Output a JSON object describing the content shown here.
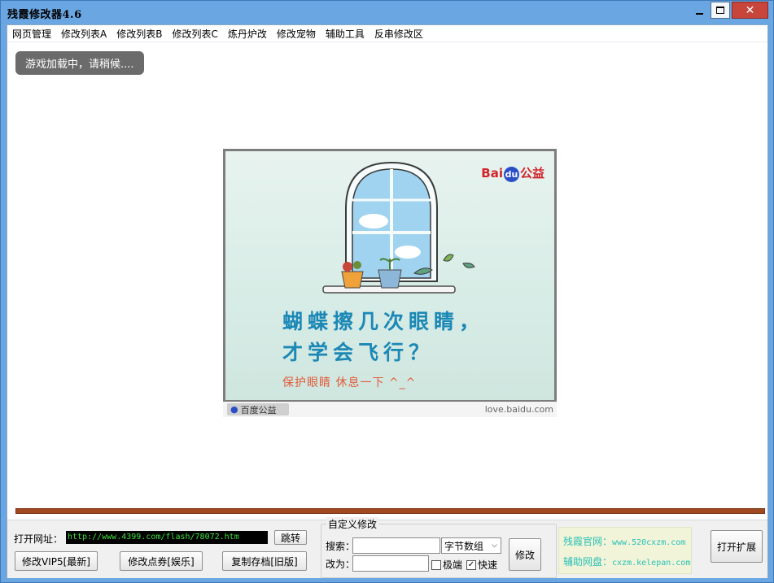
{
  "window": {
    "title": "残霞修改器4.6",
    "close_glyph": "✕"
  },
  "menu": [
    "网页管理",
    "修改列表A",
    "修改列表B",
    "修改列表C",
    "炼丹炉改",
    "修改宠物",
    "辅助工具",
    "反串修改区"
  ],
  "content": {
    "loading_text": "游戏加载中，请稍候....",
    "ad": {
      "logo_left": "Bai",
      "logo_du": "du",
      "logo_right": "公益",
      "line1": "蝴蝶擦几次眼睛，",
      "line2": "才学会飞行？",
      "subline": "保护眼睛 休息一下 ^_^",
      "footer_badge": "百度公益",
      "footer_url": "love.baidu.com"
    }
  },
  "progress": {
    "value": 100,
    "color": "#a14a22"
  },
  "bottom": {
    "open_url_label": "打开网址：",
    "url_value": "http://www.4399.com/flash/78072.htm",
    "jump_button": "跳转",
    "vip_button": "修改VIP5[最新]",
    "points_button": "修改点券[娱乐]",
    "copy_save_button": "复制存档[旧版]",
    "custom_group_title": "自定义修改",
    "search_label": "搜索：",
    "search_value": "",
    "replace_label": "改为：",
    "replace_value": "",
    "type_select": "字节数组",
    "modify_button": "修改",
    "extreme_label": "极端",
    "extreme_checked": false,
    "fast_label": "快速",
    "fast_checked": true,
    "official_label": "残霞官网：",
    "official_url": "www.520cxzm.com",
    "netdisk_label": "辅助网盘：",
    "netdisk_url": "cxzm.kelepan.com",
    "open_ext_button": "打开扩展"
  }
}
